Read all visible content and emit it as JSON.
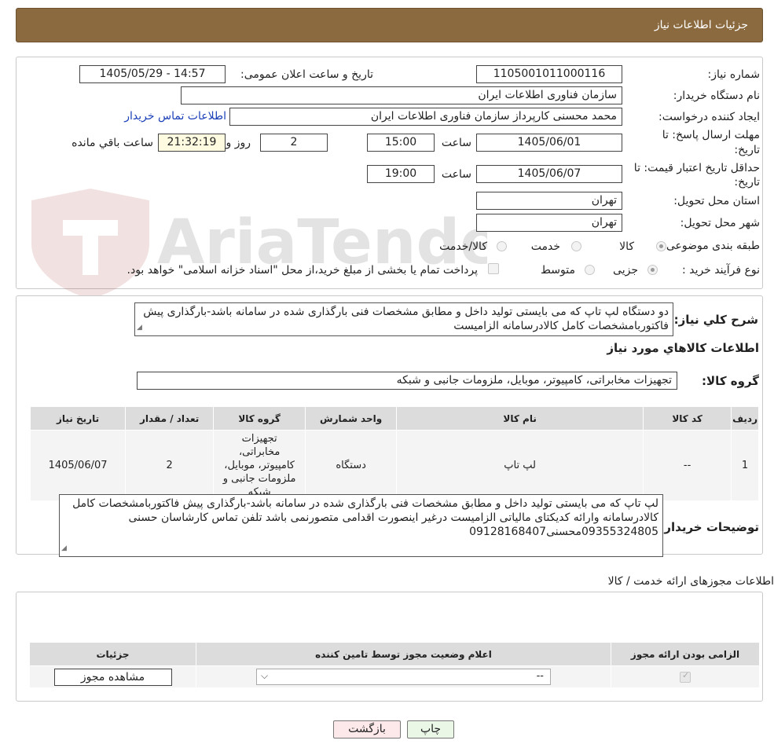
{
  "header": {
    "title": "جزئیات اطلاعات نیاز"
  },
  "form": {
    "need_number_label": "شماره نیاز:",
    "need_number": "1105001011000116",
    "announce_datetime_label": "تاریخ و ساعت اعلان عمومی:",
    "announce_datetime": "1405/05/29 - 14:57",
    "buyer_org_label": "نام دستگاه خریدار:",
    "buyer_org": "سازمان فناوری اطلاعات ایران",
    "requester_label": "ایجاد کننده درخواست:",
    "requester": "محمد محسنی کارپرداز سازمان فناوری اطلاعات ایران",
    "buyer_contact_link": "اطلاعات تماس خریدار",
    "reply_deadline_label_1": "مهلت ارسال پاسخ: تا",
    "reply_deadline_label_2": "تاریخ:",
    "reply_date": "1405/06/01",
    "time_label": "ساعت",
    "reply_time": "15:00",
    "days_value": "2",
    "days_label": "روز و",
    "remaining_time": "21:32:19",
    "remaining_label": "ساعت باقي مانده",
    "price_validity_label_1": "حداقل تاریخ اعتبار قیمت: تا",
    "price_validity_label_2": "تاریخ:",
    "price_validity_date": "1405/06/07",
    "price_validity_time": "19:00",
    "province_label": "استان محل تحویل:",
    "province": "تهران",
    "city_label": "شهر محل تحویل:",
    "city": "تهران",
    "category_label": "طبقه بندی موضوعی:",
    "category_options": [
      "کالا",
      "خدمت",
      "کالا/خدمت"
    ],
    "category_selected": "کالا",
    "purchase_process_label": "نوع فرآیند خرید :",
    "purchase_options": [
      "جزیی",
      "متوسط"
    ],
    "purchase_selected": "جزیی",
    "treasury_note": "پرداخت تمام یا بخشی از مبلغ خرید،از محل \"اسناد خزانه اسلامی\" خواهد بود."
  },
  "description": {
    "label": "شرح کلي نياز:",
    "text": "دو دستگاه لپ تاپ که می بایستی تولید داخل و مطابق مشخصات فنی بارگذاری شده در سامانه باشد-بارگذاری پیش فاکتوربامشخصات کامل کالادرسامانه الزامیست"
  },
  "goods": {
    "section_title": "اطلاعات کالاهاي مورد نياز",
    "group_label": "گروه کالا:",
    "group_value": "تجهیزات مخابراتی، کامپیوتر، موبایل، ملزومات جانبی و شبکه",
    "columns": [
      "رديف",
      "کد کالا",
      "نام کالا",
      "واحد شمارش",
      "گروه کالا",
      "تعداد / مقدار",
      "تاریخ نیاز"
    ],
    "rows": [
      {
        "row": "1",
        "code": "--",
        "name": "لپ تاپ",
        "unit": "دستگاه",
        "group": "تجهیزات مخابراتی، کامپیوتر، موبایل، ملزومات جانبی و شبکه",
        "qty": "2",
        "date": "1405/06/07"
      }
    ]
  },
  "buyer_notes": {
    "label": "توضیحات خریدار:",
    "text": "لپ تاپ که می بایستی تولید داخل و مطابق مشخصات فنی بارگذاری شده در سامانه باشد-بارگذاری پیش فاکتوربامشخصات کامل کالادرسامانه وارائه کدیکتای مالیاتی الزامیست درغیر اینصورت اقدامی متصورنمی باشد تلفن تماس  کارشاسان حسنی 09355324805محسنی09128168407"
  },
  "licenses": {
    "section_title": "اطلاعات مجوزهای ارائه خدمت / کالا",
    "columns": [
      "الزامی بودن ارائه مجوز",
      "اعلام وضعیت مجوز توسط تامین کننده",
      "جزئیات"
    ],
    "select_value": "--",
    "view_button": "مشاهده مجوز"
  },
  "footer": {
    "print_button": "چاپ",
    "back_button": "بازگشت"
  },
  "watermark": "AriaTender.neT"
}
